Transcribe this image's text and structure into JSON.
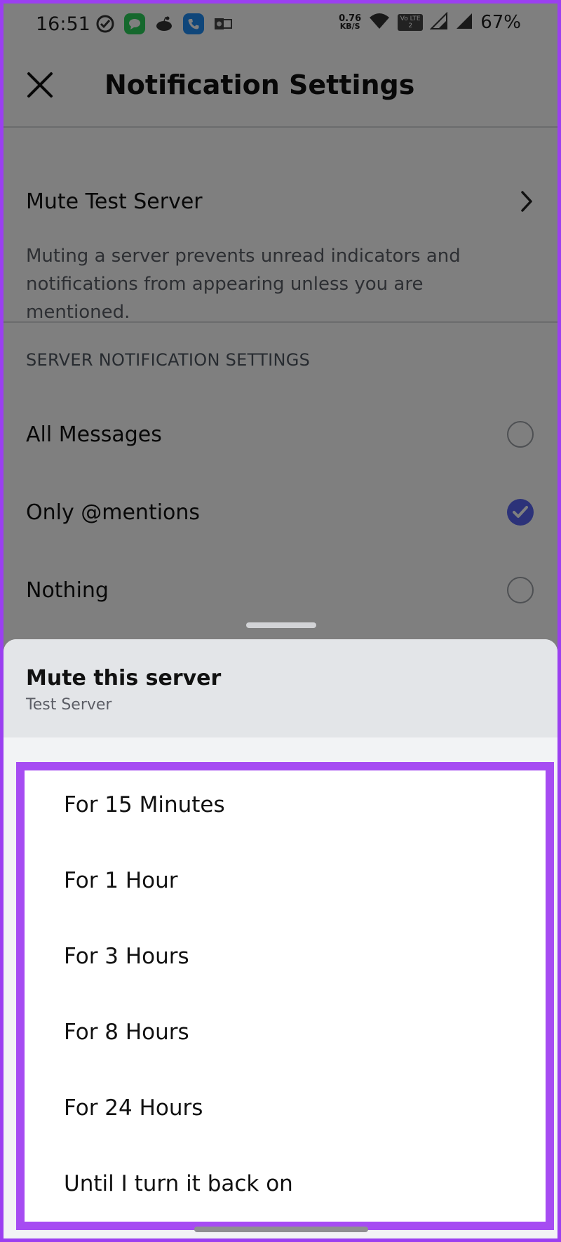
{
  "status_bar": {
    "time": "16:51",
    "net_speed_value": "0.76",
    "net_speed_unit": "KB/S",
    "volte_label": "Vo LTE 2",
    "battery": "67%"
  },
  "header": {
    "title": "Notification Settings"
  },
  "mute_row": {
    "label": "Mute Test Server",
    "description": "Muting a server prevents unread indicators and notifications from appearing unless you are mentioned."
  },
  "server_notification": {
    "heading": "SERVER NOTIFICATION SETTINGS",
    "options": [
      {
        "label": "All Messages",
        "selected": false
      },
      {
        "label": "Only @mentions",
        "selected": true
      },
      {
        "label": "Nothing",
        "selected": false
      }
    ]
  },
  "sheet": {
    "title": "Mute this server",
    "subtitle": "Test Server",
    "items": [
      "For 15 Minutes",
      "For 1 Hour",
      "For 3 Hours",
      "For 8 Hours",
      "For 24 Hours",
      "Until I turn it back on"
    ]
  },
  "colors": {
    "accent": "#5865f2",
    "highlight": "#a64cf2"
  }
}
